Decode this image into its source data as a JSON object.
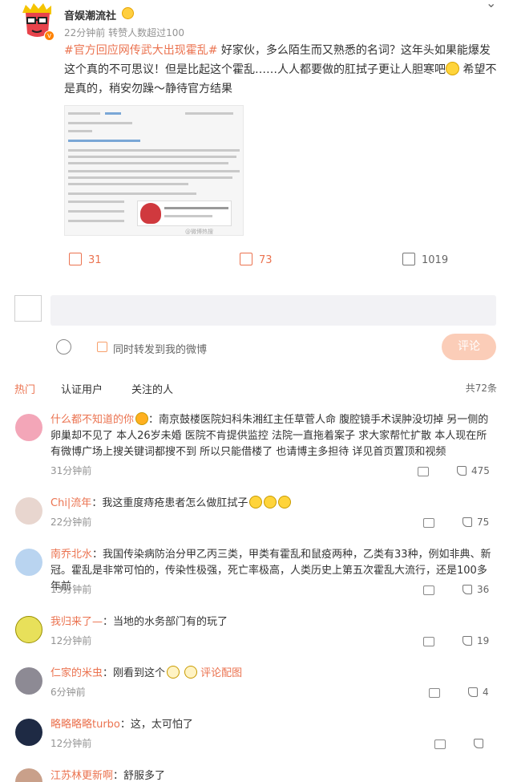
{
  "post": {
    "author": "音娱潮流社",
    "meta": "22分钟前 转赞人数超过100",
    "topic": "#官方回应网传武大出现霍乱#",
    "text_1": " 好家伙，多么陌生而又熟悉的名词？这年头如果能爆发这个真的不可思议！但是比起这个霍乱……人人都要做的肛拭子更让人胆寒吧",
    "text_2": " 希望不是真的，稍安勿躁～静待官方结果",
    "thumbnail_label": "@微博热搜",
    "forward_count": "31",
    "comment_count": "73",
    "like_count": "1019"
  },
  "composer": {
    "forward_also_label": "同时转发到我的微博",
    "submit_label": "评论"
  },
  "tabs": {
    "hot": "热门",
    "verified": "认证用户",
    "following": "关注的人",
    "total": "共72条"
  },
  "comments": [
    {
      "name": "什么都不知道的你",
      "text": "：南京鼓楼医院妇科朱湘红主任草菅人命 腹腔镜手术误肿没切掉 另一侧的卵巢却不见了 本人26岁未婚 医院不肯提供监控 法院一直拖着案子 求大家帮忙扩散 本人现在所有微博广场上搜关键词都搜不到 所以只能借楼了 也请博主多担待 详见首页置顶和视频",
      "time": "31分钟前",
      "likes": "475"
    },
    {
      "name": "Chi|流年",
      "text": "：我这重度痔疮患者怎么做肛拭子",
      "time": "22分钟前",
      "likes": "75"
    },
    {
      "name": "南乔北水",
      "text": "：我国传染病防治分甲乙丙三类，甲类有霍乱和鼠疫两种，乙类有33种，例如非典、新冠。霍乱是非常可怕的，传染性极强，死亡率极高，人类历史上第五次霍乱大流行，还是100多年前",
      "time": "13分钟前",
      "likes": "36"
    },
    {
      "name": "我归来了—",
      "text": "：当地的水务部门有的玩了",
      "time": "12分钟前",
      "likes": "19"
    },
    {
      "name": "仁家的米虫",
      "text": "：刚看到这个",
      "pic_link": "评论配图",
      "time": "6分钟前",
      "likes": "4"
    },
    {
      "name": "略略略略turbo",
      "text": "：这，太可怕了",
      "time": "12分钟前",
      "likes": ""
    },
    {
      "name": "江苏林更新啊",
      "text": "：舒服多了",
      "time": "",
      "likes": ""
    }
  ],
  "colors": {
    "accent": "#eb7350",
    "muted": "#939393",
    "button_disabled": "#fbcdb8"
  }
}
